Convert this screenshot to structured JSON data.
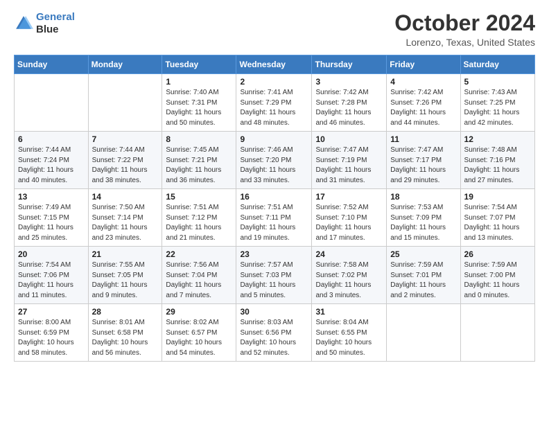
{
  "logo": {
    "line1": "General",
    "line2": "Blue"
  },
  "title": "October 2024",
  "location": "Lorenzo, Texas, United States",
  "days_of_week": [
    "Sunday",
    "Monday",
    "Tuesday",
    "Wednesday",
    "Thursday",
    "Friday",
    "Saturday"
  ],
  "weeks": [
    [
      {
        "day": "",
        "info": ""
      },
      {
        "day": "",
        "info": ""
      },
      {
        "day": "1",
        "info": "Sunrise: 7:40 AM\nSunset: 7:31 PM\nDaylight: 11 hours and 50 minutes."
      },
      {
        "day": "2",
        "info": "Sunrise: 7:41 AM\nSunset: 7:29 PM\nDaylight: 11 hours and 48 minutes."
      },
      {
        "day": "3",
        "info": "Sunrise: 7:42 AM\nSunset: 7:28 PM\nDaylight: 11 hours and 46 minutes."
      },
      {
        "day": "4",
        "info": "Sunrise: 7:42 AM\nSunset: 7:26 PM\nDaylight: 11 hours and 44 minutes."
      },
      {
        "day": "5",
        "info": "Sunrise: 7:43 AM\nSunset: 7:25 PM\nDaylight: 11 hours and 42 minutes."
      }
    ],
    [
      {
        "day": "6",
        "info": "Sunrise: 7:44 AM\nSunset: 7:24 PM\nDaylight: 11 hours and 40 minutes."
      },
      {
        "day": "7",
        "info": "Sunrise: 7:44 AM\nSunset: 7:22 PM\nDaylight: 11 hours and 38 minutes."
      },
      {
        "day": "8",
        "info": "Sunrise: 7:45 AM\nSunset: 7:21 PM\nDaylight: 11 hours and 36 minutes."
      },
      {
        "day": "9",
        "info": "Sunrise: 7:46 AM\nSunset: 7:20 PM\nDaylight: 11 hours and 33 minutes."
      },
      {
        "day": "10",
        "info": "Sunrise: 7:47 AM\nSunset: 7:19 PM\nDaylight: 11 hours and 31 minutes."
      },
      {
        "day": "11",
        "info": "Sunrise: 7:47 AM\nSunset: 7:17 PM\nDaylight: 11 hours and 29 minutes."
      },
      {
        "day": "12",
        "info": "Sunrise: 7:48 AM\nSunset: 7:16 PM\nDaylight: 11 hours and 27 minutes."
      }
    ],
    [
      {
        "day": "13",
        "info": "Sunrise: 7:49 AM\nSunset: 7:15 PM\nDaylight: 11 hours and 25 minutes."
      },
      {
        "day": "14",
        "info": "Sunrise: 7:50 AM\nSunset: 7:14 PM\nDaylight: 11 hours and 23 minutes."
      },
      {
        "day": "15",
        "info": "Sunrise: 7:51 AM\nSunset: 7:12 PM\nDaylight: 11 hours and 21 minutes."
      },
      {
        "day": "16",
        "info": "Sunrise: 7:51 AM\nSunset: 7:11 PM\nDaylight: 11 hours and 19 minutes."
      },
      {
        "day": "17",
        "info": "Sunrise: 7:52 AM\nSunset: 7:10 PM\nDaylight: 11 hours and 17 minutes."
      },
      {
        "day": "18",
        "info": "Sunrise: 7:53 AM\nSunset: 7:09 PM\nDaylight: 11 hours and 15 minutes."
      },
      {
        "day": "19",
        "info": "Sunrise: 7:54 AM\nSunset: 7:07 PM\nDaylight: 11 hours and 13 minutes."
      }
    ],
    [
      {
        "day": "20",
        "info": "Sunrise: 7:54 AM\nSunset: 7:06 PM\nDaylight: 11 hours and 11 minutes."
      },
      {
        "day": "21",
        "info": "Sunrise: 7:55 AM\nSunset: 7:05 PM\nDaylight: 11 hours and 9 minutes."
      },
      {
        "day": "22",
        "info": "Sunrise: 7:56 AM\nSunset: 7:04 PM\nDaylight: 11 hours and 7 minutes."
      },
      {
        "day": "23",
        "info": "Sunrise: 7:57 AM\nSunset: 7:03 PM\nDaylight: 11 hours and 5 minutes."
      },
      {
        "day": "24",
        "info": "Sunrise: 7:58 AM\nSunset: 7:02 PM\nDaylight: 11 hours and 3 minutes."
      },
      {
        "day": "25",
        "info": "Sunrise: 7:59 AM\nSunset: 7:01 PM\nDaylight: 11 hours and 2 minutes."
      },
      {
        "day": "26",
        "info": "Sunrise: 7:59 AM\nSunset: 7:00 PM\nDaylight: 11 hours and 0 minutes."
      }
    ],
    [
      {
        "day": "27",
        "info": "Sunrise: 8:00 AM\nSunset: 6:59 PM\nDaylight: 10 hours and 58 minutes."
      },
      {
        "day": "28",
        "info": "Sunrise: 8:01 AM\nSunset: 6:58 PM\nDaylight: 10 hours and 56 minutes."
      },
      {
        "day": "29",
        "info": "Sunrise: 8:02 AM\nSunset: 6:57 PM\nDaylight: 10 hours and 54 minutes."
      },
      {
        "day": "30",
        "info": "Sunrise: 8:03 AM\nSunset: 6:56 PM\nDaylight: 10 hours and 52 minutes."
      },
      {
        "day": "31",
        "info": "Sunrise: 8:04 AM\nSunset: 6:55 PM\nDaylight: 10 hours and 50 minutes."
      },
      {
        "day": "",
        "info": ""
      },
      {
        "day": "",
        "info": ""
      }
    ]
  ]
}
